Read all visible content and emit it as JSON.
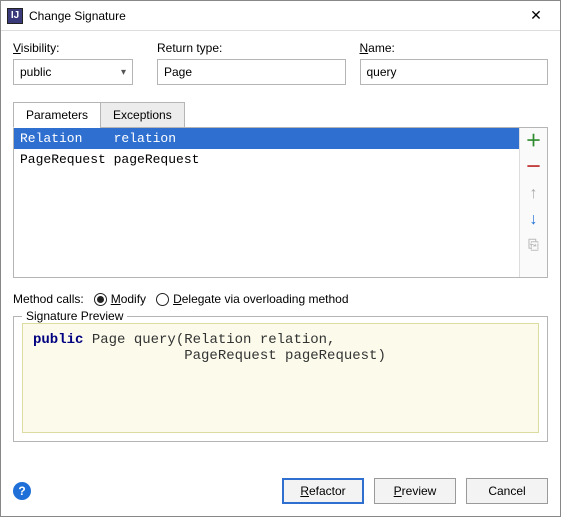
{
  "window": {
    "title": "Change Signature",
    "app_icon_text": "IJ"
  },
  "fields": {
    "visibility_label": "Visibility:",
    "visibility_mnemonic": "V",
    "visibility_value": "public",
    "return_type_label": "Return type:",
    "return_type_value": "Page",
    "name_label": "Name:",
    "name_mnemonic": "N",
    "name_value": "query"
  },
  "tabs": {
    "parameters": "Parameters",
    "exceptions": "Exceptions"
  },
  "parameters": [
    {
      "type": "Relation",
      "name": "relation",
      "selected": true
    },
    {
      "type": "PageRequest",
      "name": "pageRequest",
      "selected": false
    }
  ],
  "method_calls": {
    "label": "Method calls:",
    "modify": "Modify",
    "modify_mnemonic": "M",
    "delegate": "Delegate via overloading method",
    "delegate_mnemonic": "D",
    "selected": "modify"
  },
  "signature": {
    "legend": "Signature Preview",
    "line1_kw": "public",
    "line1_rest": " Page query(Relation relation,",
    "line2": "                  PageRequest pageRequest)"
  },
  "buttons": {
    "refactor": "Refactor",
    "refactor_mnemonic": "R",
    "preview": "Preview",
    "preview_mnemonic": "P",
    "cancel": "Cancel"
  },
  "icons": {
    "close": "✕",
    "chevron_down": "▾",
    "add": "＋",
    "remove": "－",
    "up": "↑",
    "down": "↓",
    "copy": "⎘",
    "help": "?"
  }
}
